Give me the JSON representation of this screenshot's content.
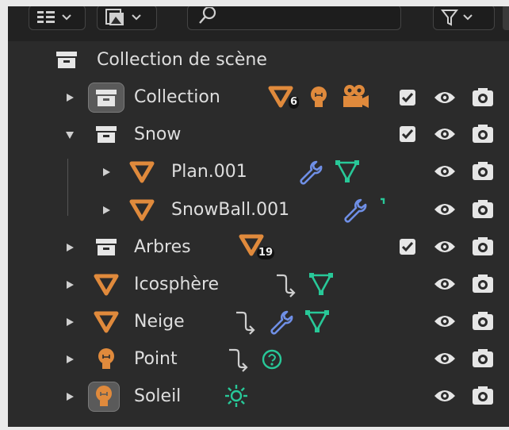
{
  "header": {
    "search_value": "",
    "icons": [
      "display-mode-icon",
      "chevron-down-icon",
      "filter-view-icon",
      "chevron-down-icon",
      "search-icon",
      "funnel-icon",
      "chevron-down-icon"
    ]
  },
  "rows": [
    {
      "label": "Collection de scène"
    },
    {
      "label": "Collection",
      "badge": "6"
    },
    {
      "label": "Snow"
    },
    {
      "label": "Plan.001"
    },
    {
      "label": "SnowBall.001"
    },
    {
      "label": "Arbres",
      "badge": "19"
    },
    {
      "label": "Icosphère"
    },
    {
      "label": "Neige"
    },
    {
      "label": "Point"
    },
    {
      "label": "Soleil"
    }
  ],
  "colors": {
    "panel_bg": "#2b2b2b",
    "header_bg": "#222222",
    "text": "#dedede",
    "object_orange": "#e08a3c",
    "modifier_blue": "#6f8fe6",
    "data_green": "#28c898",
    "icon_white": "#e6e6e6"
  }
}
